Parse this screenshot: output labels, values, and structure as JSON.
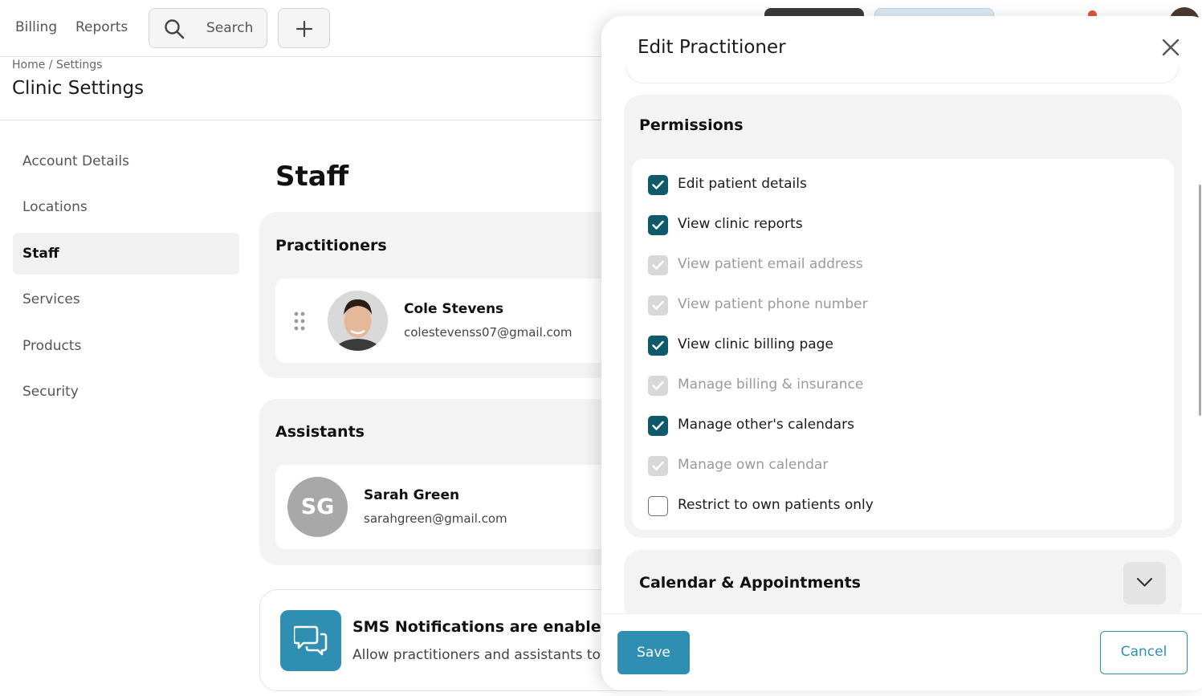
{
  "topbar": {
    "nav": [
      "Billing",
      "Reports"
    ],
    "search_label": "Search",
    "search_icon": "search-icon",
    "add_icon": "plus-icon"
  },
  "header": {
    "breadcrumb": "Home / Settings",
    "title": "Clinic Settings"
  },
  "sidebar": {
    "items": [
      {
        "label": "Account Details",
        "active": false
      },
      {
        "label": "Locations",
        "active": false
      },
      {
        "label": "Staff",
        "active": true
      },
      {
        "label": "Services",
        "active": false
      },
      {
        "label": "Products",
        "active": false
      },
      {
        "label": "Security",
        "active": false
      }
    ]
  },
  "main": {
    "heading": "Staff",
    "practitioners": {
      "title": "Practitioners",
      "people": [
        {
          "name": "Cole Stevens",
          "email": "colestevenss07@gmail.com",
          "avatar": "photo"
        }
      ]
    },
    "assistants": {
      "title": "Assistants",
      "people": [
        {
          "name": "Sarah Green",
          "email": "sarahgreen@gmail.com",
          "initials": "SG"
        }
      ]
    },
    "sms": {
      "title": "SMS Notifications are enabled fo",
      "description": "Allow practitioners and assistants to r",
      "icon": "chat-bubbles-icon"
    }
  },
  "modal": {
    "title": "Edit Practitioner",
    "permissions": {
      "title": "Permissions",
      "items": [
        {
          "label": "Edit patient details",
          "state": "checked"
        },
        {
          "label": "View clinic reports",
          "state": "checked"
        },
        {
          "label": "View patient email address",
          "state": "disabled"
        },
        {
          "label": "View patient phone number",
          "state": "disabled"
        },
        {
          "label": "View clinic billing page",
          "state": "checked"
        },
        {
          "label": "Manage billing & insurance",
          "state": "disabled"
        },
        {
          "label": "Manage other's calendars",
          "state": "checked"
        },
        {
          "label": "Manage own calendar",
          "state": "disabled"
        },
        {
          "label": "Restrict to own patients only",
          "state": "unchecked"
        }
      ]
    },
    "calendar_section": {
      "title": "Calendar & Appointments"
    },
    "footer": {
      "save": "Save",
      "cancel": "Cancel"
    }
  },
  "colors": {
    "accent": "#2e8fb3",
    "checkbox_checked": "#0f5a6a",
    "notification": "#e2543a"
  }
}
